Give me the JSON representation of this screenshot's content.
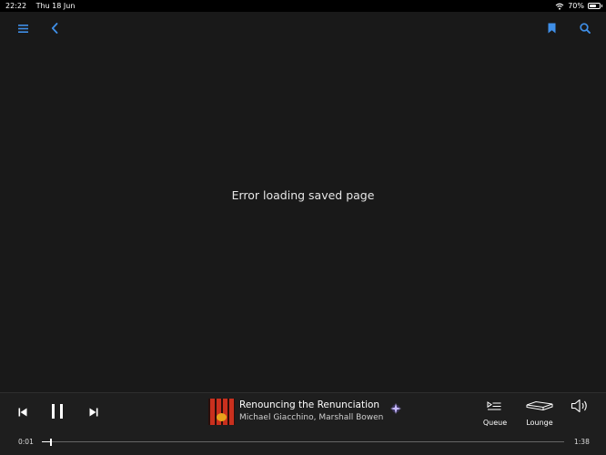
{
  "status_bar": {
    "time": "22:22",
    "date": "Thu 18 Jun",
    "battery": "70%",
    "battery_level": 0.7
  },
  "nav": {
    "menu_icon": "menu-icon",
    "back_icon": "chevron-left-icon",
    "bookmark_icon": "bookmark-icon",
    "search_icon": "search-icon"
  },
  "main": {
    "message": "Error loading saved page"
  },
  "player": {
    "track_title": "Renouncing the Renunciation",
    "track_artist": "Michael Giacchino, Marshall Bowen",
    "queue_label": "Queue",
    "device_label": "Lounge",
    "elapsed": "0:01",
    "duration": "1:38",
    "progress": 0.01
  },
  "colors": {
    "accent": "#3f8fe8",
    "background": "#191919",
    "player_bg": "#1e1e1e",
    "sparkle": "#b9a6ff"
  }
}
